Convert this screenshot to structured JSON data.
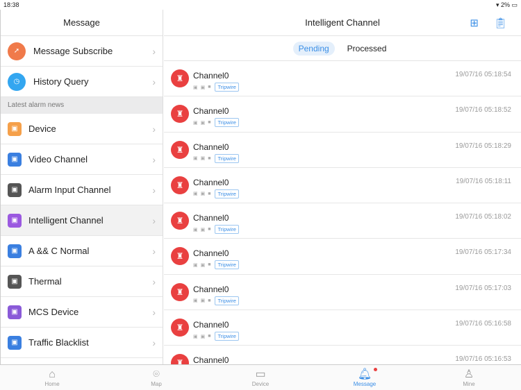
{
  "status": {
    "time": "18:38",
    "battery": "2%"
  },
  "left": {
    "title": "Message",
    "top_items": [
      {
        "label": "Message Subscribe",
        "color": "#f07a4a",
        "icon": "paper-plane-icon"
      },
      {
        "label": "History Query",
        "color": "#33a6f0",
        "icon": "clock-icon"
      }
    ],
    "section": "Latest alarm news",
    "items": [
      {
        "label": "Device",
        "color": "#f5a04a"
      },
      {
        "label": "Video Channel",
        "color": "#3a7fe0"
      },
      {
        "label": "Alarm Input Channel",
        "color": "#555555"
      },
      {
        "label": "Intelligent Channel",
        "color": "#9b59e0",
        "selected": true
      },
      {
        "label": "A && C Normal",
        "color": "#3a7fe0"
      },
      {
        "label": "Thermal",
        "color": "#555555"
      },
      {
        "label": "MCS Device",
        "color": "#8a5ad8"
      },
      {
        "label": "Traffic Blacklist",
        "color": "#3a7fe0"
      }
    ]
  },
  "right": {
    "title": "Intelligent Channel",
    "tabs": [
      "Pending",
      "Processed"
    ],
    "rows": [
      {
        "channel": "Channel0",
        "tag": "Tripwire",
        "time": "19/07/16 05:18:54"
      },
      {
        "channel": "Channel0",
        "tag": "Tripwire",
        "time": "19/07/16 05:18:52"
      },
      {
        "channel": "Channel0",
        "tag": "Tripwire",
        "time": "19/07/16 05:18:29"
      },
      {
        "channel": "Channel0",
        "tag": "Tripwire",
        "time": "19/07/16 05:18:11"
      },
      {
        "channel": "Channel0",
        "tag": "Tripwire",
        "time": "19/07/16 05:18:02"
      },
      {
        "channel": "Channel0",
        "tag": "Tripwire",
        "time": "19/07/16 05:17:34"
      },
      {
        "channel": "Channel0",
        "tag": "Tripwire",
        "time": "19/07/16 05:17:03"
      },
      {
        "channel": "Channel0",
        "tag": "Tripwire",
        "time": "19/07/16 05:16:58"
      },
      {
        "channel": "Channel0",
        "tag": "Tripwire",
        "time": "19/07/16 05:16:53"
      }
    ]
  },
  "tabbar": [
    {
      "label": "Home",
      "icon": "home-icon"
    },
    {
      "label": "Map",
      "icon": "map-pin-icon"
    },
    {
      "label": "Device",
      "icon": "device-icon"
    },
    {
      "label": "Message",
      "icon": "bell-icon",
      "active": true
    },
    {
      "label": "Mine",
      "icon": "person-icon"
    }
  ]
}
